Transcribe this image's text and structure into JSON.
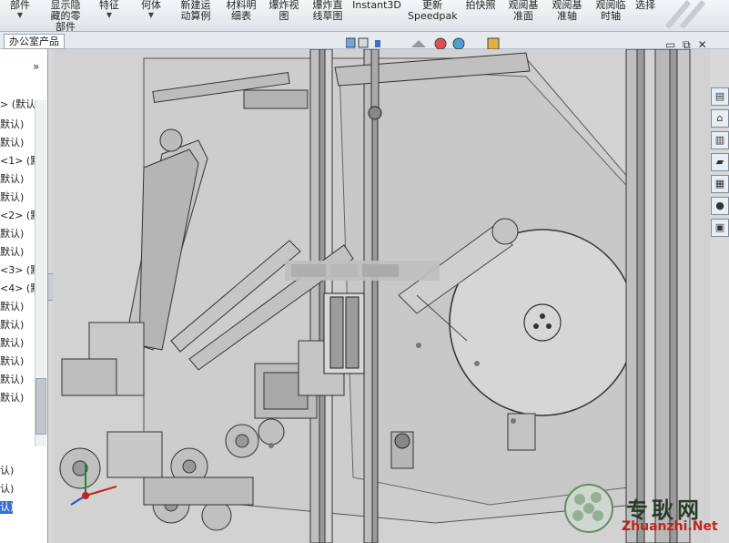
{
  "ribbon": {
    "buttons": [
      {
        "label": "部件"
      },
      {
        "label": "显示隐\n藏的零\n部件"
      },
      {
        "label": "特征"
      },
      {
        "label": "何体"
      },
      {
        "label": "新建运\n动算例"
      },
      {
        "label": "材料明\n细表"
      },
      {
        "label": "爆炸视\n图"
      },
      {
        "label": "爆炸直\n线草图"
      },
      {
        "label": "Instant3D"
      },
      {
        "label": "更新\nSpeedpak"
      },
      {
        "label": "拍快照"
      },
      {
        "label": "观阅基\n准面"
      },
      {
        "label": "观阅基\n准轴"
      },
      {
        "label": "观阅临\n时轴"
      },
      {
        "label": "选择"
      }
    ]
  },
  "tabs": {
    "feature_tab": "办公室产品"
  },
  "tree": {
    "items": [
      "> (默认",
      "默认)",
      "默认)",
      "<1> (默",
      "默认)",
      "默认)",
      "<2> (默",
      "默认)",
      "默认)",
      "<3> (默",
      "<4> (默",
      "默认)",
      "默认)",
      "默认)",
      "默认)",
      "默认)",
      "默认)",
      "认)",
      "认)",
      "认)"
    ]
  },
  "window_controls": {
    "minimize": "▭",
    "restore": "⧉",
    "close": "✕"
  },
  "watermark": {
    "text": "专耿网",
    "domain": "Zhuanzhi.Net"
  },
  "colors": {
    "viewport_bg": "#d2d2d2",
    "selected_row": "#3a6ed1",
    "watermark_red": "#c0241c"
  }
}
